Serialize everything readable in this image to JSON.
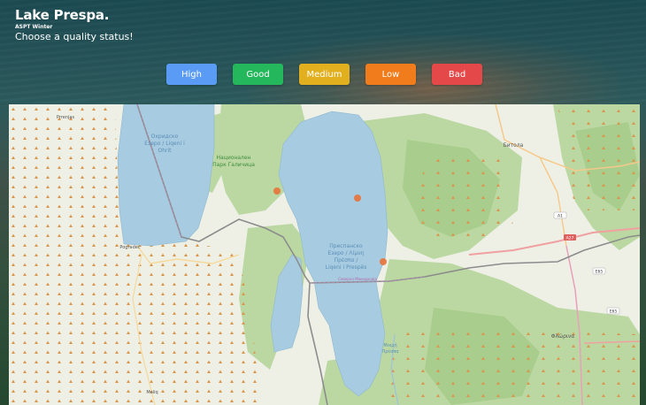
{
  "header": {
    "title": "Lake Prespa.",
    "subtitle": "ASPT Winter",
    "prompt": "Choose a quality status!"
  },
  "quality_buttons": [
    {
      "label": "High",
      "color": "#5a9cf5"
    },
    {
      "label": "Good",
      "color": "#24b75c"
    },
    {
      "label": "Medium",
      "color": "#e2b01e"
    },
    {
      "label": "Low",
      "color": "#f07c1c"
    },
    {
      "label": "Bad",
      "color": "#e54848"
    }
  ],
  "map": {
    "labels": {
      "ohrid": [
        "Охридско",
        "Езеро / Liqeni i",
        "Ohrit"
      ],
      "park": [
        "Национален",
        "Парк Галичица"
      ],
      "prespa": [
        "Преспанско",
        "Езеро / Λίμνη",
        "Πρέσπα /",
        "Liqeni i Prespës"
      ],
      "bitola": "Битола",
      "pogradec": "Pogradec",
      "prrenjas": "Prrenjas",
      "florina": "Φλώρινα",
      "border": "Северна Македонија",
      "mikri": [
        "Μικρή",
        "Πρέσπα"
      ],
      "maliq": "Maliq",
      "road_a1": "A1",
      "road_a27": "A27",
      "road_e65a": "E65",
      "road_e65b": "E65"
    },
    "sample_point_color": "#e8733a"
  }
}
